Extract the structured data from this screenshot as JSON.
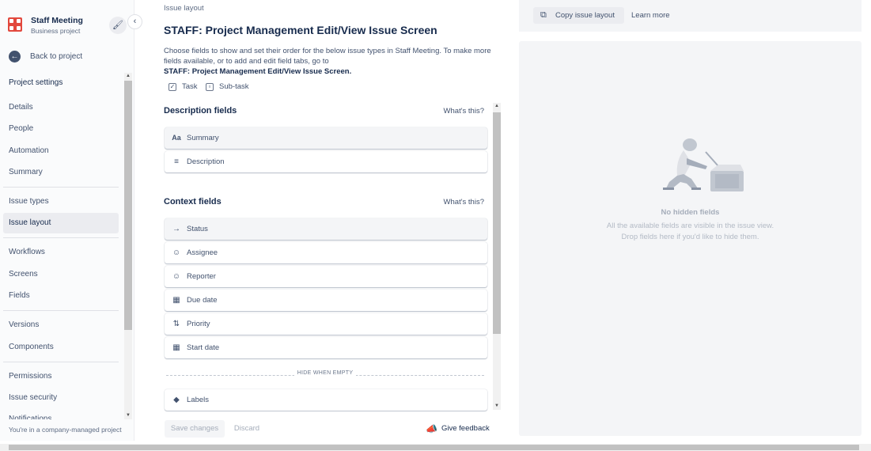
{
  "project": {
    "name": "Staff Meeting",
    "type": "Business project",
    "back_label": "Back to project"
  },
  "nav": {
    "section_title": "Project settings",
    "items": [
      {
        "label": "Details"
      },
      {
        "label": "People"
      },
      {
        "label": "Automation"
      },
      {
        "label": "Summary"
      },
      {
        "label": "Issue types"
      },
      {
        "label": "Issue layout"
      },
      {
        "label": "Workflows"
      },
      {
        "label": "Screens"
      },
      {
        "label": "Fields"
      },
      {
        "label": "Versions"
      },
      {
        "label": "Components"
      },
      {
        "label": "Permissions"
      },
      {
        "label": "Issue security"
      },
      {
        "label": "Notifications"
      }
    ],
    "active_item": "Issue layout",
    "footer": "You're in a company-managed project"
  },
  "main": {
    "breadcrumb": "Issue layout",
    "title": "STAFF: Project Management Edit/View Issue Screen",
    "description": "Choose fields to show and set their order for the below issue types in Staff Meeting. To make more fields available, or to add and edit field tabs, go to",
    "description_link": "STAFF: Project Management Edit/View Issue Screen.",
    "issue_types": [
      {
        "label": "Task",
        "icon": "task-icon"
      },
      {
        "label": "Sub-task",
        "icon": "subtask-icon"
      }
    ],
    "description_fields": {
      "heading": "Description fields",
      "help": "What's this?",
      "fields": [
        {
          "label": "Summary",
          "icon": "text-aa-icon"
        },
        {
          "label": "Description",
          "icon": "paragraph-icon"
        }
      ]
    },
    "context_fields": {
      "heading": "Context fields",
      "help": "What's this?",
      "fields": [
        {
          "label": "Status",
          "icon": "arrow-right-icon"
        },
        {
          "label": "Assignee",
          "icon": "person-icon"
        },
        {
          "label": "Reporter",
          "icon": "person-icon"
        },
        {
          "label": "Due date",
          "icon": "calendar-icon"
        },
        {
          "label": "Priority",
          "icon": "priority-arrows-icon"
        },
        {
          "label": "Start date",
          "icon": "calendar-icon"
        }
      ],
      "hide_when_empty": "HIDE WHEN EMPTY",
      "hidden_fields": [
        {
          "label": "Labels",
          "icon": "tag-icon"
        }
      ]
    },
    "save_label": "Save changes",
    "discard_label": "Discard",
    "feedback_label": "Give feedback"
  },
  "right": {
    "copy_label": "Copy issue layout",
    "learn_more": "Learn more",
    "empty_title": "No hidden fields",
    "empty_line1": "All the available fields are visible in the issue view.",
    "empty_line2": "Drop fields here if you'd like to hide them."
  }
}
